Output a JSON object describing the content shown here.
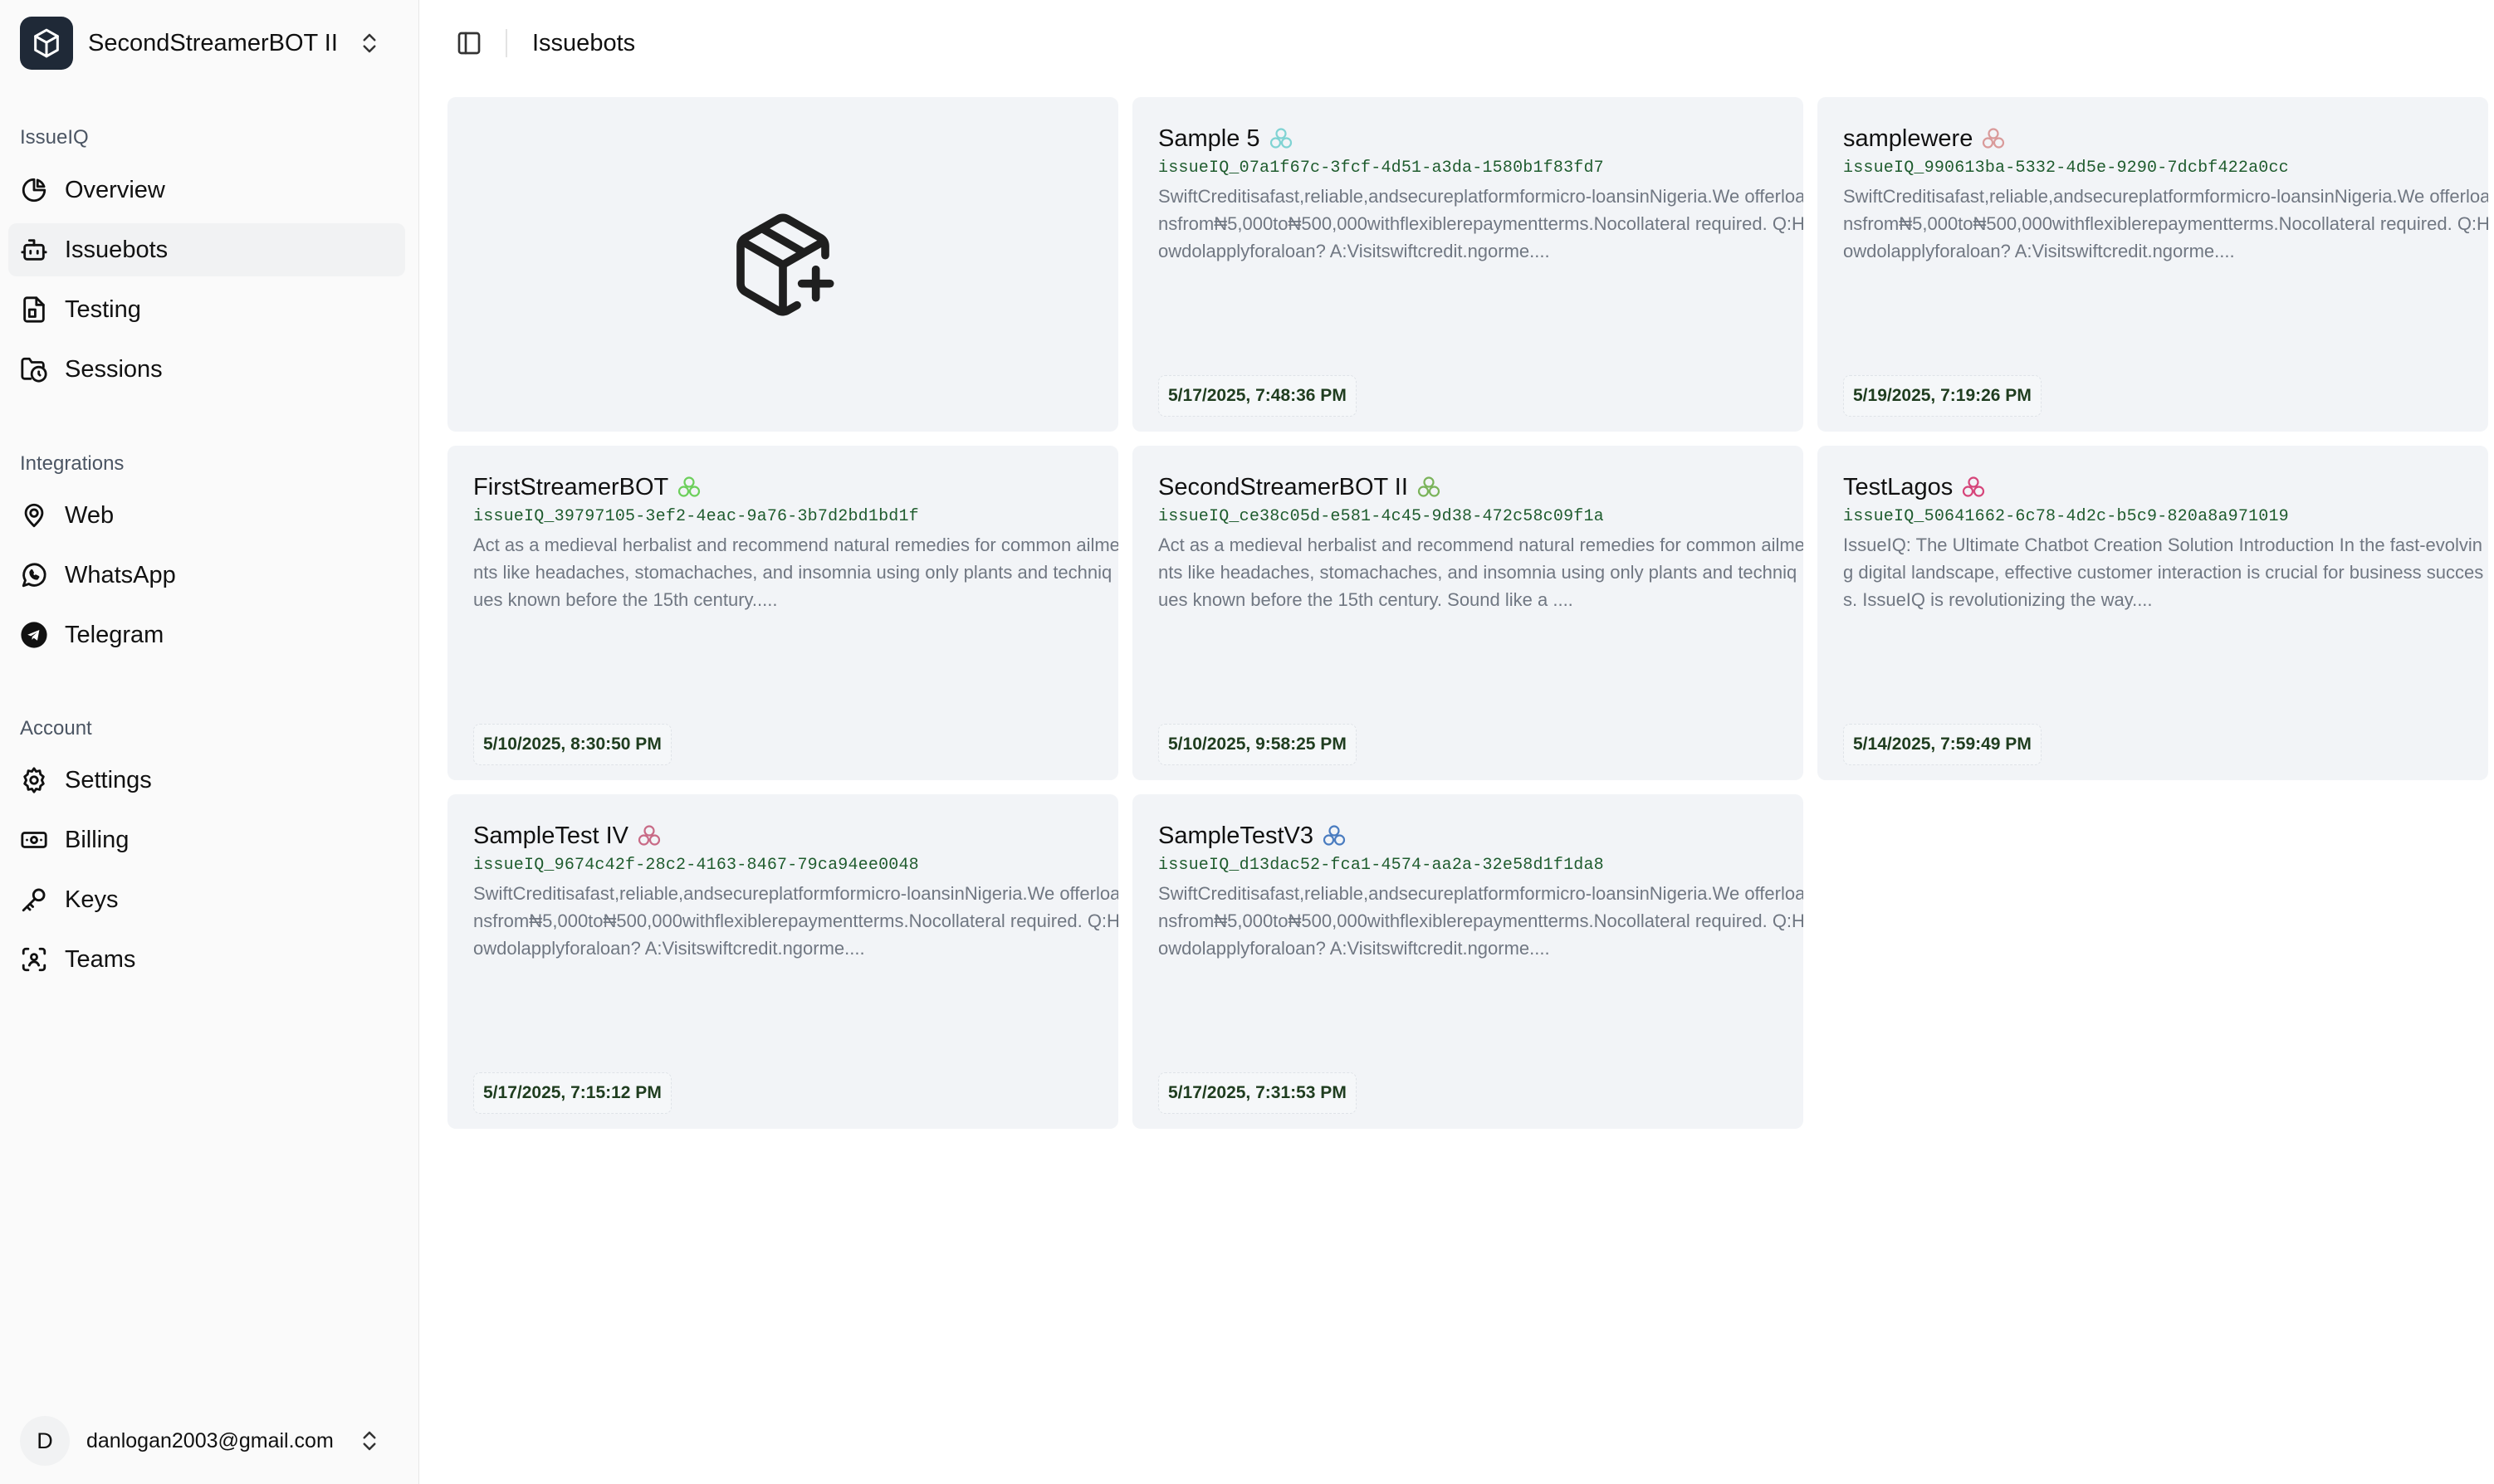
{
  "workspace": {
    "name": "SecondStreamerBOT II"
  },
  "sidebar": {
    "sections": [
      {
        "label": "IssueIQ",
        "items": [
          {
            "label": "Overview",
            "icon": "pie-chart-icon",
            "active": false
          },
          {
            "label": "Issuebots",
            "icon": "bot-icon",
            "active": true
          },
          {
            "label": "Testing",
            "icon": "file-test-icon",
            "active": false
          },
          {
            "label": "Sessions",
            "icon": "folder-clock-icon",
            "active": false
          }
        ]
      },
      {
        "label": "Integrations",
        "items": [
          {
            "label": "Web",
            "icon": "map-pin-icon",
            "active": false
          },
          {
            "label": "WhatsApp",
            "icon": "whatsapp-icon",
            "active": false
          },
          {
            "label": "Telegram",
            "icon": "telegram-icon",
            "active": false
          }
        ]
      },
      {
        "label": "Account",
        "items": [
          {
            "label": "Settings",
            "icon": "gear-icon",
            "active": false
          },
          {
            "label": "Billing",
            "icon": "banknote-icon",
            "active": false
          },
          {
            "label": "Keys",
            "icon": "key-icon",
            "active": false
          },
          {
            "label": "Teams",
            "icon": "scan-face-icon",
            "active": false
          }
        ]
      }
    ]
  },
  "account": {
    "avatar_letter": "D",
    "email": "danlogan2003@gmail.com"
  },
  "header": {
    "title": "Issuebots"
  },
  "create_card": {
    "icon": "package-plus-icon"
  },
  "bots": [
    {
      "name": "Sample 5",
      "id": "issueIQ_07a1f67c-3fcf-4d51-a3da-1580b1f83fd7",
      "description": "SwiftCreditisafast,reliable,andsecureplatformformicro-loansinNigeria.We offerloansfrom₦5,000to₦500,000withflexiblerepaymentterms.Nocollateral required. Q:Howdolapplyforaloan? A:Visitswiftcredit.ngorme....",
      "date": "5/17/2025, 7:48:36 PM",
      "dot_color": "#7fd3d3"
    },
    {
      "name": "samplewere",
      "id": "issueIQ_990613ba-5332-4d5e-9290-7dcbf422a0cc",
      "description": "SwiftCreditisafast,reliable,andsecureplatformformicro-loansinNigeria.We offerloansfrom₦5,000to₦500,000withflexiblerepaymentterms.Nocollateral required. Q:Howdolapplyforaloan? A:Visitswiftcredit.ngorme....",
      "date": "5/19/2025, 7:19:26 PM",
      "dot_color": "#d99a9a"
    },
    {
      "name": "FirstStreamerBOT",
      "id": "issueIQ_39797105-3ef2-4eac-9a76-3b7d2bd1bd1f",
      "description": "Act as a medieval herbalist and recommend natural remedies for common ailments like headaches, stomachaches, and insomnia using only plants and techniques known before the 15th century.....",
      "date": "5/10/2025, 8:30:50 PM",
      "dot_color": "#6ccf5b"
    },
    {
      "name": "SecondStreamerBOT II",
      "id": "issueIQ_ce38c05d-e581-4c45-9d38-472c58c09f1a",
      "description": "Act as a medieval herbalist and recommend natural remedies for common ailments like headaches, stomachaches, and insomnia using only plants and techniques known before the 15th century. Sound like a ....",
      "date": "5/10/2025, 9:58:25 PM",
      "dot_color": "#7ab35a"
    },
    {
      "name": "TestLagos",
      "id": "issueIQ_50641662-6c78-4d2c-b5c9-820a8a971019",
      "description": "IssueIQ: The Ultimate Chatbot Creation Solution Introduction In the fast-evolving digital landscape, effective customer interaction is crucial for business success. IssueIQ is revolutionizing the way....",
      "date": "5/14/2025, 7:59:49 PM",
      "dot_color": "#d6457a"
    },
    {
      "name": "SampleTest IV",
      "id": "issueIQ_9674c42f-28c2-4163-8467-79ca94ee0048",
      "description": "SwiftCreditisafast,reliable,andsecureplatformformicro-loansinNigeria.We offerloansfrom₦5,000to₦500,000withflexiblerepaymentterms.Nocollateral required. Q:Howdolapplyforaloan? A:Visitswiftcredit.ngorme....",
      "date": "5/17/2025, 7:15:12 PM",
      "dot_color": "#c86a86"
    },
    {
      "name": "SampleTestV3",
      "id": "issueIQ_d13dac52-fca1-4574-aa2a-32e58d1f1da8",
      "description": "SwiftCreditisafast,reliable,andsecureplatformformicro-loansinNigeria.We offerloansfrom₦5,000to₦500,000withflexiblerepaymentterms.Nocollateral required. Q:Howdolapplyforaloan? A:Visitswiftcredit.ngorme....",
      "date": "5/17/2025, 7:31:53 PM",
      "dot_color": "#4a7cc0"
    }
  ]
}
